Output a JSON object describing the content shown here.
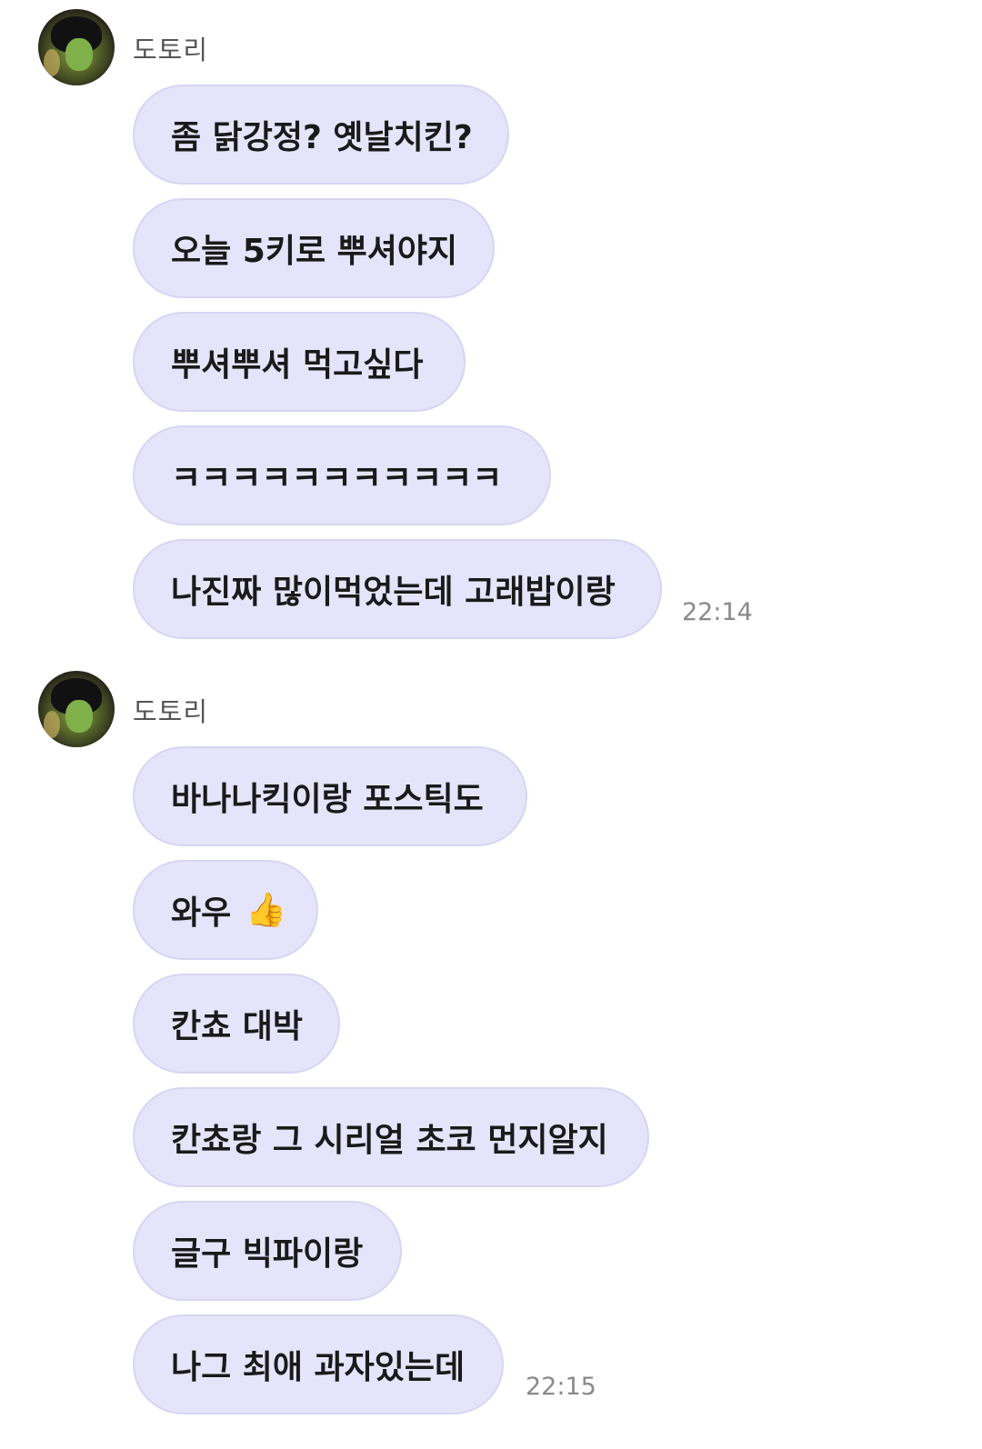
{
  "groups": [
    {
      "sender": "도토리",
      "messages": [
        "좀 닭강정? 옛날치킨?",
        "오늘 5키로 뿌셔야지",
        "뿌셔뿌셔 먹고싶다",
        "ㅋㅋㅋㅋㅋㅋㅋㅋㅋㅋㅋ",
        "나진짜 많이먹었는데 고래밥이랑"
      ],
      "time": "22:14"
    },
    {
      "sender": "도토리",
      "messages": [
        "바나나킥이랑 포스틱도",
        "와우",
        "칸쵸 대박",
        "칸쵸랑 그 시리얼 초코 먼지알지",
        "글구 빅파이랑",
        "나그 최애 과자있는데"
      ],
      "time": "22:15"
    }
  ],
  "icons": {
    "thumbs_up": "👍"
  },
  "colors": {
    "bubble": "#e6e4fa",
    "bubble_border": "#d8d5f3",
    "sender_text": "#555555",
    "time_text": "#8a8a8a"
  }
}
